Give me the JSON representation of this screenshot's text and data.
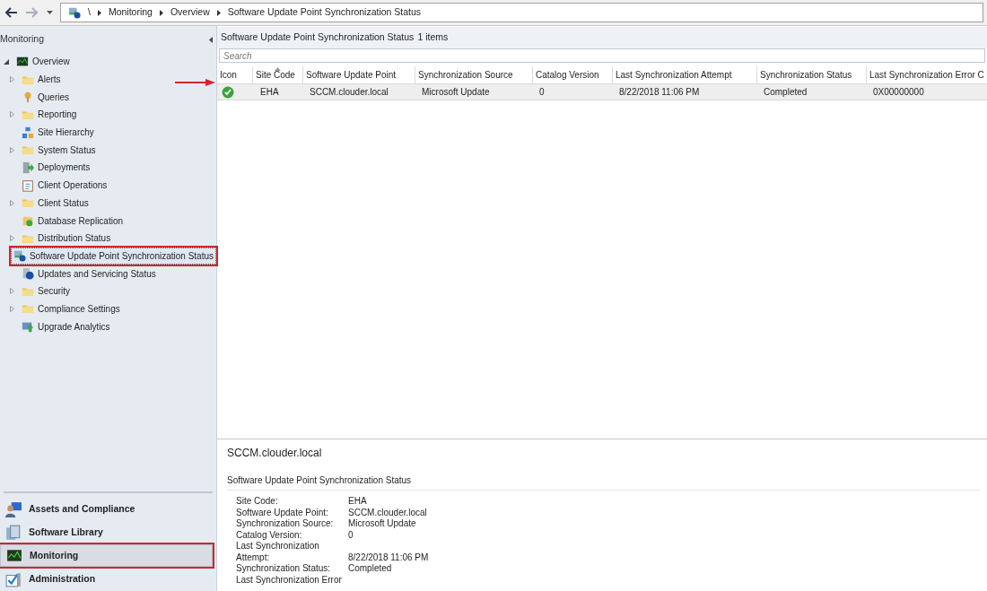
{
  "breadcrumb": [
    "\\",
    "Monitoring",
    "Overview",
    "Software Update Point Synchronization Status"
  ],
  "navigation": {
    "title": "Monitoring",
    "tree": [
      {
        "label": "Overview",
        "kind": "monitor",
        "expanded": true,
        "children": [
          {
            "label": "Alerts",
            "kind": "folder",
            "expandable": true,
            "selected": false
          },
          {
            "label": "Queries",
            "kind": "query",
            "expandable": false,
            "selected": false
          },
          {
            "label": "Reporting",
            "kind": "folder",
            "expandable": true,
            "selected": false
          },
          {
            "label": "Site Hierarchy",
            "kind": "hierarchy",
            "expandable": false,
            "selected": false
          },
          {
            "label": "System Status",
            "kind": "folder",
            "expandable": true,
            "selected": false
          },
          {
            "label": "Deployments",
            "kind": "deploy",
            "expandable": false,
            "selected": false
          },
          {
            "label": "Client Operations",
            "kind": "clipboard",
            "expandable": false,
            "selected": false
          },
          {
            "label": "Client Status",
            "kind": "folder",
            "expandable": true,
            "selected": false
          },
          {
            "label": "Database Replication",
            "kind": "database",
            "expandable": false,
            "selected": false
          },
          {
            "label": "Distribution Status",
            "kind": "folder",
            "expandable": true,
            "selected": false
          },
          {
            "label": "Software Update Point Synchronization Status",
            "kind": "sync",
            "expandable": false,
            "selected": true
          },
          {
            "label": "Updates and Servicing Status",
            "kind": "info",
            "expandable": false,
            "selected": false
          },
          {
            "label": "Security",
            "kind": "folder",
            "expandable": true,
            "selected": false
          },
          {
            "label": "Compliance Settings",
            "kind": "folder",
            "expandable": true,
            "selected": false
          },
          {
            "label": "Upgrade Analytics",
            "kind": "upgrade",
            "expandable": false,
            "selected": false
          }
        ]
      }
    ]
  },
  "workspaces": [
    {
      "label": "Assets and Compliance",
      "kind": "user",
      "selected": false
    },
    {
      "label": "Software Library",
      "kind": "library",
      "selected": false
    },
    {
      "label": "Monitoring",
      "kind": "monitor",
      "selected": true
    },
    {
      "label": "Administration",
      "kind": "admin",
      "selected": false
    }
  ],
  "list": {
    "title": "Software Update Point Synchronization Status",
    "count": "1 items",
    "search": {
      "placeholder": "Search"
    },
    "columns": [
      "Icon",
      "Site Code",
      "Software Update Point",
      "Synchronization Source",
      "Catalog Version",
      "Last Synchronization Attempt",
      "Synchronization Status",
      "Last Synchronization Error C"
    ],
    "rows": [
      {
        "selected": true,
        "kind": "success",
        "cells": [
          "",
          "EHA",
          "SCCM.clouder.local",
          "Microsoft Update",
          "0",
          "8/22/2018 11:06 PM",
          "Completed",
          "0X00000000"
        ]
      }
    ]
  },
  "details": {
    "title": "SCCM.clouder.local",
    "section": "Software Update Point Synchronization Status",
    "fields": [
      {
        "label": "Site Code:",
        "value": "EHA"
      },
      {
        "label": "Software Update Point:",
        "value": "SCCM.clouder.local"
      },
      {
        "label": "Synchronization Source:",
        "value": "Microsoft Update"
      },
      {
        "label": "Catalog Version:",
        "value": "0"
      },
      {
        "label": "Last Synchronization Attempt:",
        "value": "8/22/2018 11:06 PM"
      },
      {
        "label": "Synchronization Status:",
        "value": "Completed"
      },
      {
        "label": "Last Synchronization Error"
      }
    ]
  }
}
